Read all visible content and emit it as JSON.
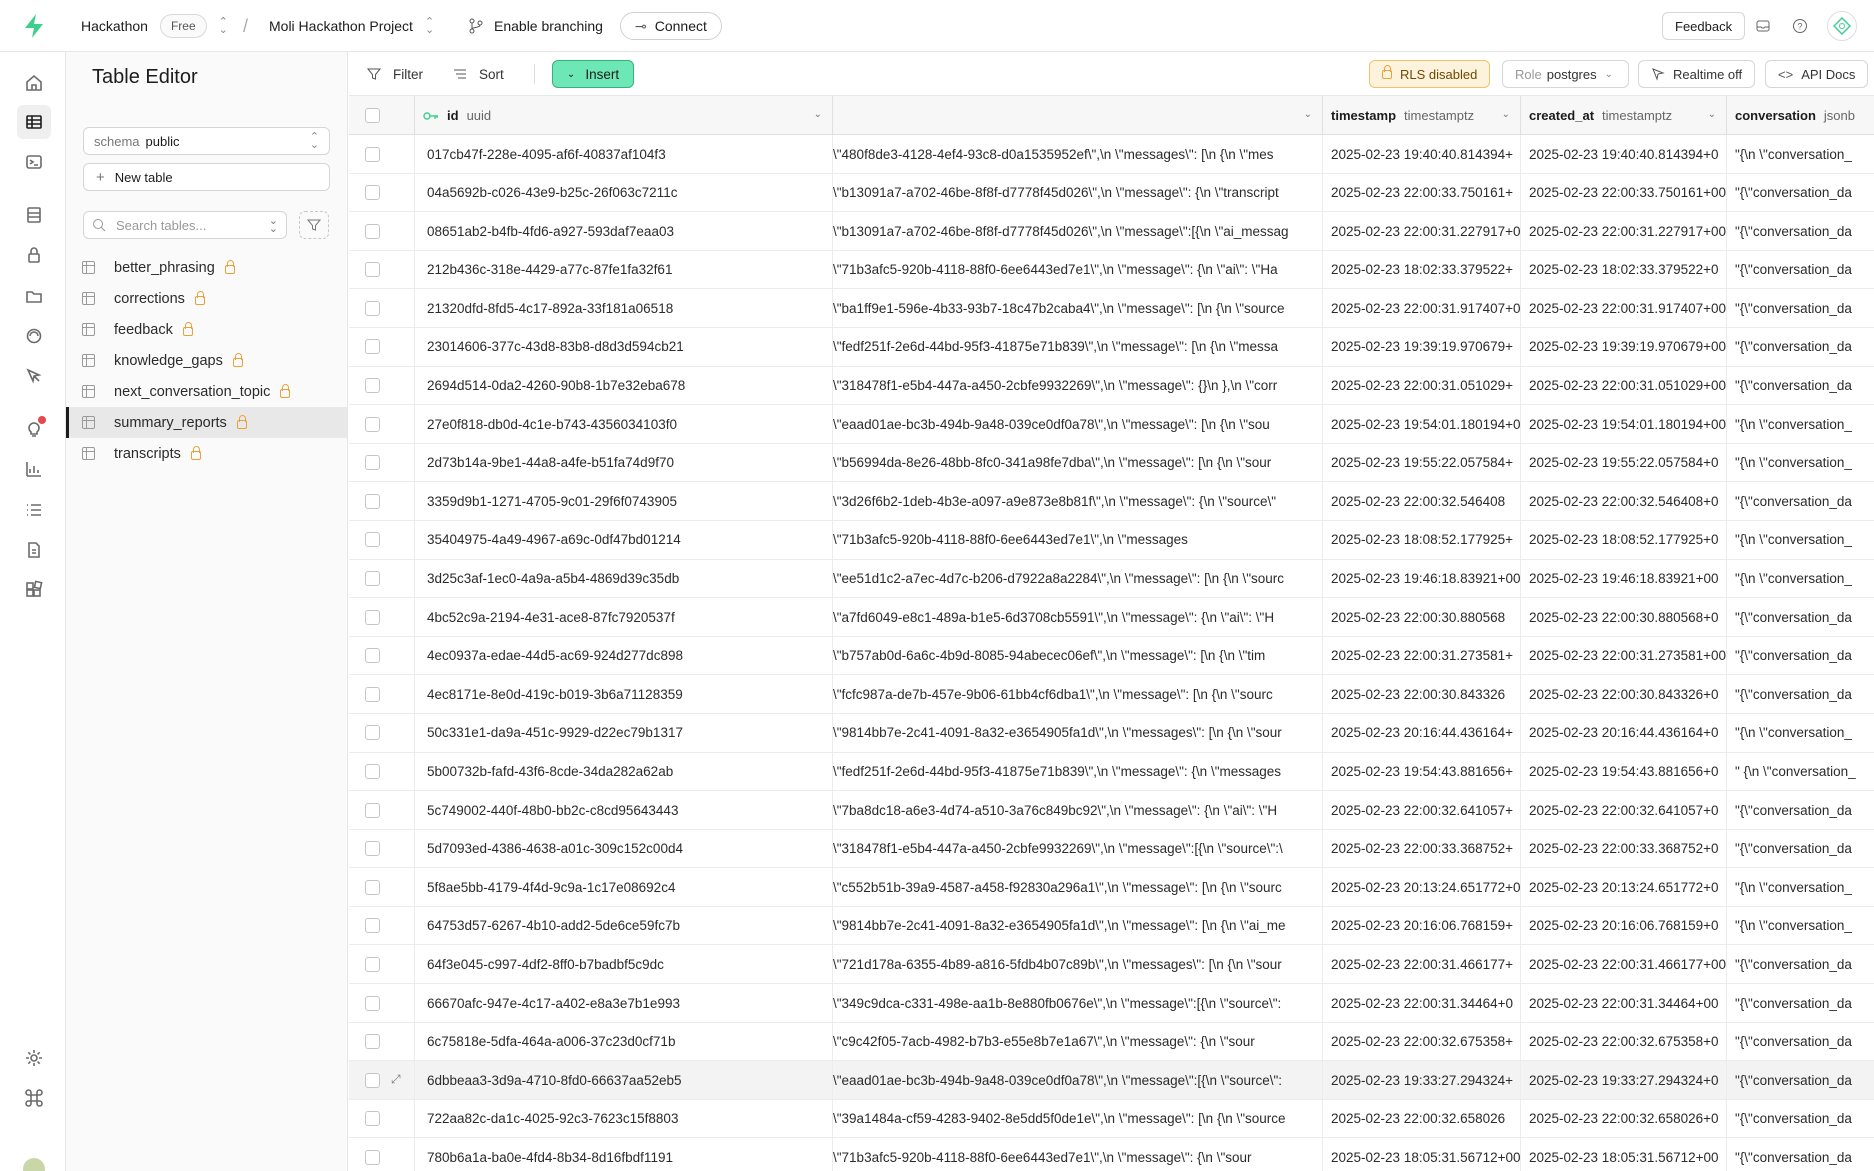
{
  "topbar": {
    "org": "Hackathon",
    "plan": "Free",
    "project": "Moli Hackathon Project",
    "branching": "Enable branching",
    "connect": "Connect",
    "feedback": "Feedback"
  },
  "sidebar": {
    "title": "Table Editor",
    "schema_label": "schema",
    "schema_value": "public",
    "new_table": "New table",
    "search_placeholder": "Search tables...",
    "tables": [
      {
        "name": "better_phrasing"
      },
      {
        "name": "corrections"
      },
      {
        "name": "feedback"
      },
      {
        "name": "knowledge_gaps"
      },
      {
        "name": "next_conversation_topic"
      },
      {
        "name": "summary_reports"
      },
      {
        "name": "transcripts"
      }
    ],
    "active_table": "summary_reports"
  },
  "toolbar": {
    "filter": "Filter",
    "sort": "Sort",
    "insert": "Insert",
    "rls": "RLS disabled",
    "role_label": "Role",
    "role_value": "postgres",
    "realtime": "Realtime off",
    "api_docs": "API Docs"
  },
  "columns": [
    {
      "name": "id",
      "type": "uuid"
    },
    {
      "name": "",
      "type": ""
    },
    {
      "name": "timestamp",
      "type": "timestamptz"
    },
    {
      "name": "created_at",
      "type": "timestamptz"
    },
    {
      "name": "conversation",
      "type": "jsonb"
    }
  ],
  "rows": [
    {
      "id": "017cb47f-228e-4095-af6f-40837af104f3",
      "json": "\\\"480f8de3-4128-4ef4-93c8-d0a1535952ef\\\",\\n \\\"messages\\\": [\\n {\\n \\\"mes",
      "ts": "2025-02-23 19:40:40.814394+",
      "created": "2025-02-23 19:40:40.814394+0",
      "conv": "\"{\\n \\\"conversation_"
    },
    {
      "id": "04a5692b-c026-43e9-b25c-26f063c7211c",
      "json": "\\\"b13091a7-a702-46be-8f8f-d7778f45d026\\\",\\n \\\"message\\\": {\\n \\\"transcript",
      "ts": "2025-02-23 22:00:33.750161+",
      "created": "2025-02-23 22:00:33.750161+00",
      "conv": "\"{\\\"conversation_da"
    },
    {
      "id": "08651ab2-b4fb-4fd6-a927-593daf7eaa03",
      "json": "\\\"b13091a7-a702-46be-8f8f-d7778f45d026\\\",\\n \\\"message\\\":[{\\n \\\"ai_messag",
      "ts": "2025-02-23 22:00:31.227917+0",
      "created": "2025-02-23 22:00:31.227917+00",
      "conv": "\"{\\\"conversation_da"
    },
    {
      "id": "212b436c-318e-4429-a77c-87fe1fa32f61",
      "json": "\\\"71b3afc5-920b-4118-88f0-6ee6443ed7e1\\\",\\n \\\"message\\\": {\\n \\\"ai\\\": \\\"Ha",
      "ts": "2025-02-23 18:02:33.379522+",
      "created": "2025-02-23 18:02:33.379522+0",
      "conv": "\"{\\\"conversation_da"
    },
    {
      "id": "21320dfd-8fd5-4c17-892a-33f181a06518",
      "json": "\\\"ba1ff9e1-596e-4b33-93b7-18c47b2caba4\\\",\\n \\\"message\\\": [\\n {\\n \\\"source",
      "ts": "2025-02-23 22:00:31.917407+0",
      "created": "2025-02-23 22:00:31.917407+00",
      "conv": "\"{\\\"conversation_da"
    },
    {
      "id": "23014606-377c-43d8-83b8-d8d3d594cb21",
      "json": "\\\"fedf251f-2e6d-44bd-95f3-41875e71b839\\\",\\n \\\"message\\\": [\\n {\\n \\\"messa",
      "ts": "2025-02-23 19:39:19.970679+",
      "created": "2025-02-23 19:39:19.970679+00",
      "conv": "\"{\\\"conversation_da"
    },
    {
      "id": "2694d514-0da2-4260-90b8-1b7e32eba678",
      "json": "\\\"318478f1-e5b4-447a-a450-2cbfe9932269\\\",\\n \\\"message\\\": {}\\n },\\n \\\"corr",
      "ts": "2025-02-23 22:00:31.051029+",
      "created": "2025-02-23 22:00:31.051029+00",
      "conv": "\"{\\\"conversation_da"
    },
    {
      "id": "27e0f818-db0d-4c1e-b743-4356034103f0",
      "json": "\\\"eaad01ae-bc3b-494b-9a48-039ce0df0a78\\\",\\n \\\"message\\\": [\\n {\\n \\\"sou",
      "ts": "2025-02-23 19:54:01.180194+0",
      "created": "2025-02-23 19:54:01.180194+00",
      "conv": "\"{\\n \\\"conversation_"
    },
    {
      "id": "2d73b14a-9be1-44a8-a4fe-b51fa74d9f70",
      "json": "\\\"b56994da-8e26-48bb-8fc0-341a98fe7dba\\\",\\n \\\"message\\\": [\\n {\\n \\\"sour",
      "ts": "2025-02-23 19:55:22.057584+",
      "created": "2025-02-23 19:55:22.057584+0",
      "conv": "\"{\\n \\\"conversation_"
    },
    {
      "id": "3359d9b1-1271-4705-9c01-29f6f0743905",
      "json": "\\\"3d26f6b2-1deb-4b3e-a097-a9e873e8b81f\\\",\\n \\\"message\\\": {\\n \\\"source\\\"",
      "ts": "2025-02-23 22:00:32.546408",
      "created": "2025-02-23 22:00:32.546408+0",
      "conv": "\"{\\\"conversation_da"
    },
    {
      "id": "35404975-4a49-4967-a69c-0df47bd01214",
      "json": "\\\"71b3afc5-920b-4118-88f0-6ee6443ed7e1\\\",\\n \\\"messages",
      "ts": "2025-02-23 18:08:52.177925+",
      "created": "2025-02-23 18:08:52.177925+0",
      "conv": "\"{\\n \\\"conversation_"
    },
    {
      "id": "3d25c3af-1ec0-4a9a-a5b4-4869d39c35db",
      "json": "\\\"ee51d1c2-a7ec-4d7c-b206-d7922a8a2284\\\",\\n \\\"message\\\": [\\n {\\n \\\"sourc",
      "ts": "2025-02-23 19:46:18.83921+00",
      "created": "2025-02-23 19:46:18.83921+00",
      "conv": "\"{\\n \\\"conversation_"
    },
    {
      "id": "4bc52c9a-2194-4e31-ace8-87fc7920537f",
      "json": "\\\"a7fd6049-e8c1-489a-b1e5-6d3708cb5591\\\",\\n \\\"message\\\": {\\n \\\"ai\\\": \\\"H",
      "ts": "2025-02-23 22:00:30.880568",
      "created": "2025-02-23 22:00:30.880568+0",
      "conv": "\"{\\\"conversation_da"
    },
    {
      "id": "4ec0937a-edae-44d5-ac69-924d277dc898",
      "json": "\\\"b757ab0d-6a6c-4b9d-8085-94abecec06ef\\\",\\n \\\"message\\\": [\\n {\\n \\\"tim",
      "ts": "2025-02-23 22:00:31.273581+",
      "created": "2025-02-23 22:00:31.273581+00",
      "conv": "\"{\\\"conversation_da"
    },
    {
      "id": "4ec8171e-8e0d-419c-b019-3b6a71128359",
      "json": "\\\"fcfc987a-de7b-457e-9b06-61bb4cf6dba1\\\",\\n \\\"message\\\": [\\n {\\n \\\"sourc",
      "ts": "2025-02-23 22:00:30.843326",
      "created": "2025-02-23 22:00:30.843326+0",
      "conv": "\"{\\\"conversation_da"
    },
    {
      "id": "50c331e1-da9a-451c-9929-d22ec79b1317",
      "json": "\\\"9814bb7e-2c41-4091-8a32-e3654905fa1d\\\",\\n \\\"messages\\\": [\\n {\\n \\\"sour",
      "ts": "2025-02-23 20:16:44.436164+",
      "created": "2025-02-23 20:16:44.436164+0",
      "conv": "\"{\\n \\\"conversation_"
    },
    {
      "id": "5b00732b-fafd-43f6-8cde-34da282a62ab",
      "json": "\\\"fedf251f-2e6d-44bd-95f3-41875e71b839\\\",\\n \\\"message\\\": {\\n \\\"messages",
      "ts": "2025-02-23 19:54:43.881656+",
      "created": "2025-02-23 19:54:43.881656+0",
      "conv": "\" {\\n \\\"conversation_"
    },
    {
      "id": "5c749002-440f-48b0-bb2c-c8cd95643443",
      "json": "\\\"7ba8dc18-a6e3-4d74-a510-3a76c849bc92\\\",\\n \\\"message\\\": {\\n \\\"ai\\\": \\\"H",
      "ts": "2025-02-23 22:00:32.641057+",
      "created": "2025-02-23 22:00:32.641057+0",
      "conv": "\"{\\\"conversation_da"
    },
    {
      "id": "5d7093ed-4386-4638-a01c-309c152c00d4",
      "json": "\\\"318478f1-e5b4-447a-a450-2cbfe9932269\\\",\\n \\\"message\\\":[{\\n \\\"source\\\":\\",
      "ts": "2025-02-23 22:00:33.368752+",
      "created": "2025-02-23 22:00:33.368752+0",
      "conv": "\"{\\\"conversation_da"
    },
    {
      "id": "5f8ae5bb-4179-4f4d-9c9a-1c17e08692c4",
      "json": "\\\"c552b51b-39a9-4587-a458-f92830a296a1\\\",\\n \\\"message\\\": [\\n {\\n \\\"sourc",
      "ts": "2025-02-23 20:13:24.651772+0",
      "created": "2025-02-23 20:13:24.651772+0",
      "conv": "\"{\\n \\\"conversation_"
    },
    {
      "id": "64753d57-6267-4b10-add2-5de6ce59fc7b",
      "json": "\\\"9814bb7e-2c41-4091-8a32-e3654905fa1d\\\",\\n \\\"message\\\": [\\n {\\n \\\"ai_me",
      "ts": "2025-02-23 20:16:06.768159+",
      "created": "2025-02-23 20:16:06.768159+0",
      "conv": "\"{\\n \\\"conversation_"
    },
    {
      "id": "64f3e045-c997-4df2-8ff0-b7badbf5c9dc",
      "json": "\\\"721d178a-6355-4b89-a816-5fdb4b07c89b\\\",\\n \\\"messages\\\": [\\n {\\n \\\"sour",
      "ts": "2025-02-23 22:00:31.466177+",
      "created": "2025-02-23 22:00:31.466177+00",
      "conv": "\"{\\\"conversation_da"
    },
    {
      "id": "66670afc-947e-4c17-a402-e8a3e7b1e993",
      "json": "\\\"349c9dca-c331-498e-aa1b-8e880fb0676e\\\",\\n \\\"message\\\":[{\\n \\\"source\\\":",
      "ts": "2025-02-23 22:00:31.34464+0",
      "created": "2025-02-23 22:00:31.34464+00",
      "conv": "\"{\\\"conversation_da"
    },
    {
      "id": "6c75818e-5dfa-464a-a006-37c23d0cf71b",
      "json": "\\\"c9c42f05-7acb-4982-b7b3-e55e8b7e1a67\\\",\\n \\\"message\\\": {\\n \\\"sour",
      "ts": "2025-02-23 22:00:32.675358+",
      "created": "2025-02-23 22:00:32.675358+0",
      "conv": "\"{\\\"conversation_da"
    },
    {
      "id": "6dbbeaa3-3d9a-4710-8fd0-66637aa52eb5",
      "json": "\\\"eaad01ae-bc3b-494b-9a48-039ce0df0a78\\\",\\n \\\"message\\\":[{\\n \\\"source\\\":",
      "ts": "2025-02-23 19:33:27.294324+",
      "created": "2025-02-23 19:33:27.294324+0",
      "conv": "\"{\\\"conversation_da"
    },
    {
      "id": "722aa82c-da1c-4025-92c3-7623c15f8803",
      "json": "\\\"39a1484a-cf59-4283-9402-8e5dd5f0de1e\\\",\\n \\\"message\\\": [\\n {\\n \\\"source",
      "ts": "2025-02-23 22:00:32.658026",
      "created": "2025-02-23 22:00:32.658026+0",
      "conv": "\"{\\\"conversation_da"
    },
    {
      "id": "780b6a1a-ba0e-4fd4-8b34-8d16fbdf1191",
      "json": "\\\"71b3afc5-920b-4118-88f0-6ee6443ed7e1\\\",\\n \\\"message\\\": {\\n \\\"sour",
      "ts": "2025-02-23 18:05:31.56712+00",
      "created": "2025-02-23 18:05:31.56712+00",
      "conv": "\"{\\\"conversation_da"
    }
  ],
  "highlighted_row": 24,
  "colors": {
    "accent": "#3ecf8e",
    "insert_bg": "#6ee7b7",
    "rls_bg": "#fdf3dc",
    "lock": "#e8a23a"
  }
}
